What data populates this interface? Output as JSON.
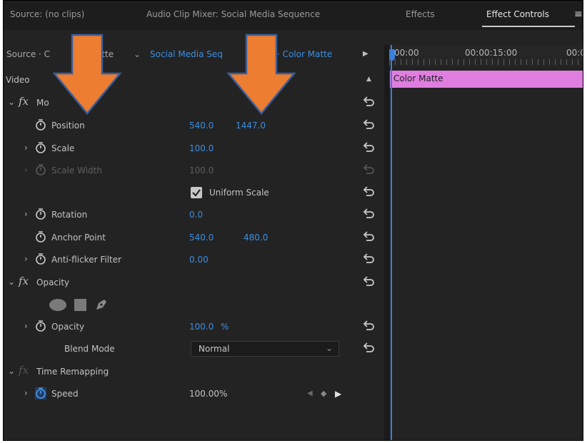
{
  "tabs": {
    "source": "Source: (no clips)",
    "mixer": "Audio Clip Mixer: Social Media Sequence",
    "effects": "Effects",
    "effect_controls": "Effect Controls"
  },
  "source_row": {
    "source": "Source · C",
    "matte": "atte",
    "sequence": "Social Media Seq",
    "clip": "· Color Matte"
  },
  "video_header": "Video",
  "motion": {
    "label": "Mo",
    "position": {
      "label": "Position",
      "x": "540.0",
      "y": "1447.0"
    },
    "scale": {
      "label": "Scale",
      "value": "100.0"
    },
    "scale_width": {
      "label": "Scale Width",
      "value": "100.0"
    },
    "uniform_scale": {
      "label": "Uniform Scale",
      "checked": true
    },
    "rotation": {
      "label": "Rotation",
      "value": "0.0"
    },
    "anchor_point": {
      "label": "Anchor Point",
      "x": "540.0",
      "y": "480.0"
    },
    "anti_flicker": {
      "label": "Anti-flicker Filter",
      "value": "0.00"
    }
  },
  "opacity_group": {
    "label": "Opacity",
    "opacity": {
      "label": "Opacity",
      "value": "100.0",
      "unit": "%"
    },
    "blend_mode": {
      "label": "Blend Mode",
      "value": "Normal"
    }
  },
  "time_remapping": {
    "label": "Time Remapping",
    "speed": {
      "label": "Speed",
      "value": "100.00%"
    }
  },
  "timeline": {
    "t0": "00:00",
    "t1": "00:00:15:00",
    "t2": "00:0",
    "clip_label": "Color Matte"
  },
  "colors": {
    "value_blue": "#3d8ee0",
    "clip_pink": "#e07ee0",
    "arrow_orange": "#ed7d31",
    "arrow_outline": "#3a5f9a"
  }
}
